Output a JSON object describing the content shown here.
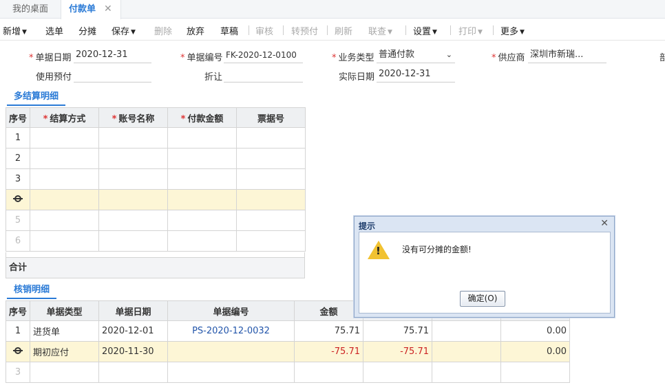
{
  "tabs": {
    "desktop": "我的桌面",
    "active": "付款单",
    "close": "✕"
  },
  "toolbar": {
    "new": "新增",
    "select_order": "选单",
    "allocate": "分摊",
    "save": "保存",
    "delete": "删除",
    "abandon": "放弃",
    "draft": "草稿",
    "audit": "审核",
    "to_prepay": "转预付",
    "refresh": "刷新",
    "link_query": "联查",
    "settings": "设置",
    "print": "打印",
    "more": "更多"
  },
  "form": {
    "doc_date_label": "单据日期",
    "doc_date": "2020-12-31",
    "doc_no_label": "单据编号",
    "doc_no": "FK-2020-12-0100",
    "biz_type_label": "业务类型",
    "biz_type": "普通付款",
    "supplier_label": "供应商",
    "supplier": "深圳市新瑞...",
    "dept_label": "部",
    "use_prepay_label": "使用预付",
    "use_prepay": "",
    "discount_label": "折让",
    "discount": "",
    "actual_date_label": "实际日期",
    "actual_date": "2020-12-31"
  },
  "settle": {
    "title": "多结算明细",
    "headers": [
      "序号",
      "结算方式",
      "账号名称",
      "付款金额",
      "票据号"
    ],
    "rows": [
      "1",
      "2",
      "3",
      "",
      "5",
      "6"
    ],
    "total_label": "合计"
  },
  "verify": {
    "title": "核销明细",
    "headers": [
      "序号",
      "单据类型",
      "单据日期",
      "单据编号",
      "金额",
      "",
      "",
      ""
    ],
    "rows": [
      {
        "no": "1",
        "type": "进货单",
        "date": "2020-12-01",
        "doc_no": "PS-2020-12-0032",
        "amount": "75.71",
        "c2": "75.71",
        "c3": "",
        "c4": "0.00"
      },
      {
        "no": "",
        "type": "期初应付",
        "date": "2020-11-30",
        "doc_no": "",
        "amount": "-75.71",
        "c2": "-75.71",
        "c3": "",
        "c4": "0.00"
      },
      {
        "no": "3",
        "type": "",
        "date": "",
        "doc_no": "",
        "amount": "",
        "c2": "",
        "c3": "",
        "c4": ""
      }
    ]
  },
  "dialog": {
    "title": "提示",
    "close": "✕",
    "message": "没有可分摊的金额!",
    "ok": "确定(O)"
  },
  "colors": {
    "accent": "#2a7ad6",
    "required": "#d33",
    "negative": "#c22",
    "highlight_row": "#fdf6d6"
  }
}
